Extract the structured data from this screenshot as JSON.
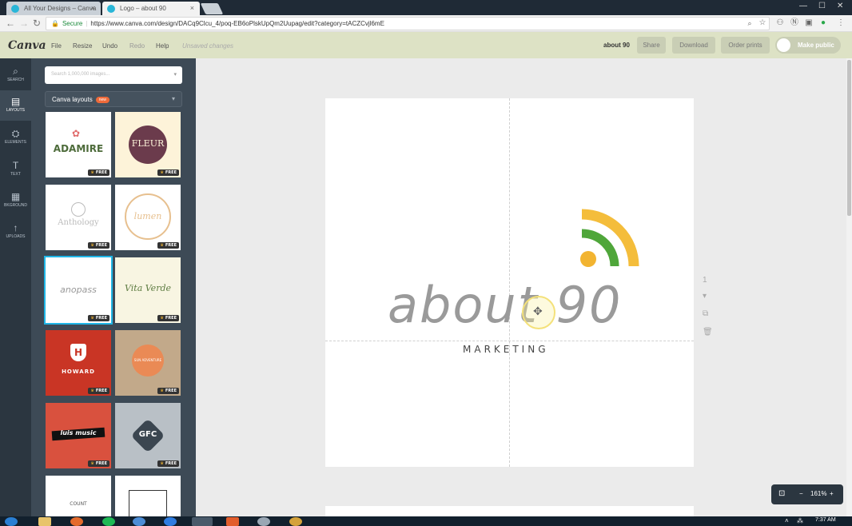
{
  "browser": {
    "tabs": [
      {
        "title": "All Your Designs – Canva"
      },
      {
        "title": "Logo – about 90"
      }
    ],
    "url": {
      "secure_label": "Secure",
      "address": "https://www.canva.com/design/DACq9Clcu_4/poq-EB6oPlskUpQm2Uupag/edit?category=tACZCvjl6mE"
    }
  },
  "menubar": {
    "logo": "Canva",
    "items": [
      {
        "label": "File"
      },
      {
        "label": "Resize"
      },
      {
        "label": "Undo"
      },
      {
        "label": "Redo"
      },
      {
        "label": "Help"
      }
    ],
    "status": "Unsaved changes",
    "design_title": "about 90",
    "buttons": {
      "share": "Share",
      "download": "Download",
      "order_prints": "Order prints",
      "make_public": "Make public"
    }
  },
  "leftnav": {
    "items": [
      {
        "label": "SEARCH",
        "icon": "search-icon"
      },
      {
        "label": "LAYOUTS",
        "icon": "layouts-icon"
      },
      {
        "label": "ELEMENTS",
        "icon": "elements-icon"
      },
      {
        "label": "TEXT",
        "icon": "text-icon"
      },
      {
        "label": "BKGROUND",
        "icon": "background-icon"
      },
      {
        "label": "UPLOADS",
        "icon": "uploads-icon"
      }
    ]
  },
  "panel": {
    "search_placeholder": "Search 1,000,000 images...",
    "dropdown_label": "Canva layouts",
    "dropdown_badge": "new",
    "free_label": "FREE",
    "thumbs": [
      {
        "text": "ADAMIRE"
      },
      {
        "text": "FLEUR"
      },
      {
        "text": "Anthology"
      },
      {
        "text": "lumen"
      },
      {
        "text": "anopass"
      },
      {
        "text": "Vita Verde"
      },
      {
        "text": "HOWARD"
      },
      {
        "text": "SUN ADVENTURE"
      },
      {
        "text": "luis music"
      },
      {
        "text": "GFC"
      },
      {
        "text": "COUNT"
      },
      {
        "text": ""
      }
    ]
  },
  "canvas": {
    "wordmark": "about 90",
    "tagline": "MARKETING",
    "page_number": "1",
    "zoom_level": "161%",
    "logo_colors": {
      "orange": "#f4bd3b",
      "green": "#4fa63a",
      "dot": "#f2b431"
    }
  },
  "taskbar": {
    "time": "7:37 AM"
  }
}
